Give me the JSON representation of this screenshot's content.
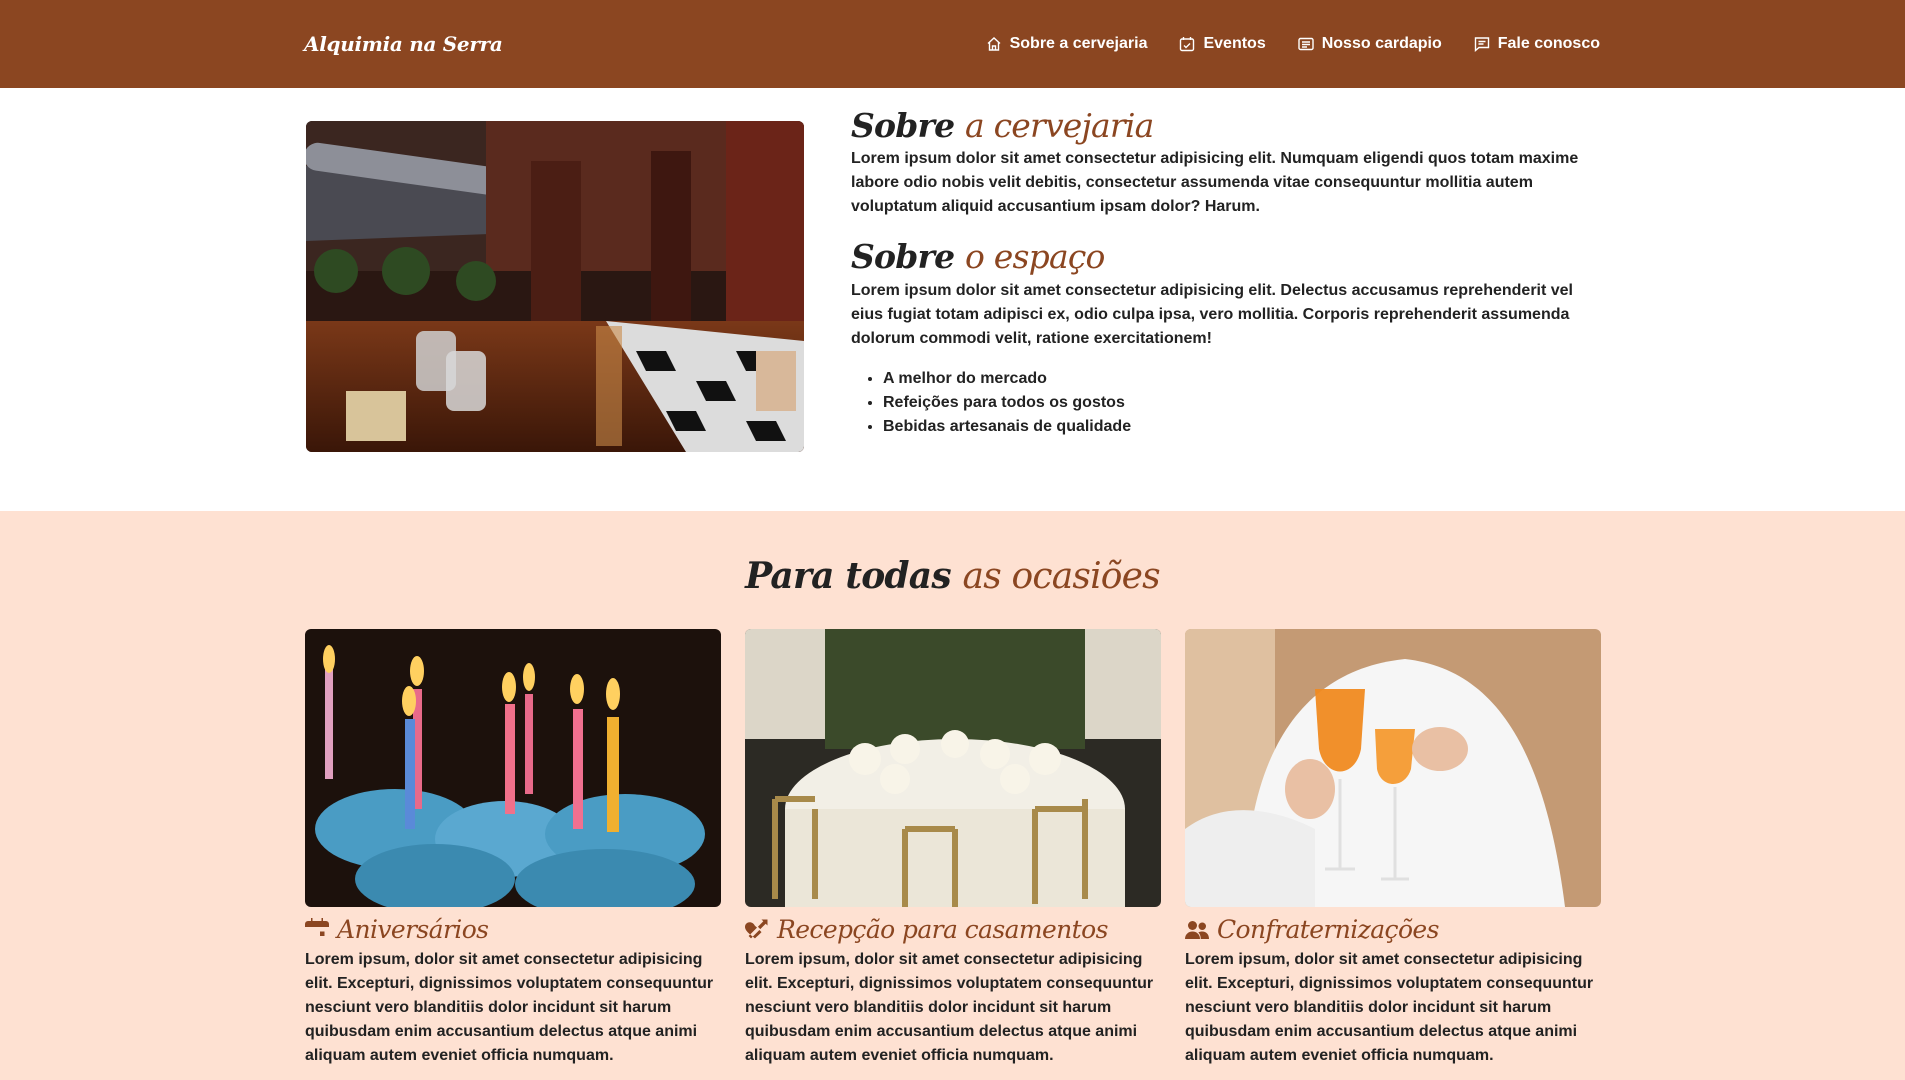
{
  "brand": "Alquimia na Serra",
  "nav": [
    {
      "label": "Sobre a cervejaria",
      "icon": "house-icon"
    },
    {
      "label": "Eventos",
      "icon": "calendar-check-icon"
    },
    {
      "label": "Nosso cardapio",
      "icon": "card-text-icon"
    },
    {
      "label": "Fale conosco",
      "icon": "chat-square-text-icon"
    }
  ],
  "about": {
    "heading1_a": "Sobre",
    "heading1_b": "a cervejaria",
    "para1": "Lorem ipsum dolor sit amet consectetur adipisicing elit. Numquam eligendi quos totam maxime labore odio nobis velit debitis, consectetur assumenda vitae consequuntur mollitia autem voluptatum aliquid accusantium ipsam dolor? Harum.",
    "heading2_a": "Sobre",
    "heading2_b": "o espaço",
    "para2": "Lorem ipsum dolor sit amet consectetur adipisicing elit. Delectus accusamus reprehenderit vel eius fugiat totam adipisci ex, odio culpa ipsa, vero mollitia. Corporis reprehenderit assumenda dolorum commodi velit, ratione exercitationem!",
    "bullets": [
      "A melhor do mercado",
      "Refeições para todos os gostos",
      "Bebidas artesanais de qualidade"
    ]
  },
  "occasions": {
    "title_a": "Para todas",
    "title_b": "as ocasiões",
    "cards": [
      {
        "title": "Aniversários",
        "icon": "calendar-event-icon",
        "text": "Lorem ipsum, dolor sit amet consectetur adipisicing elit. Excepturi, dignissimos voluptatem consequuntur nesciunt vero blanditiis dolor incidunt sit harum quibusdam enim accusantium delectus atque animi aliquam autem eveniet officia numquam."
      },
      {
        "title": "Recepção para casamentos",
        "icon": "heart-arrow-icon",
        "text": "Lorem ipsum, dolor sit amet consectetur adipisicing elit. Excepturi, dignissimos voluptatem consequuntur nesciunt vero blanditiis dolor incidunt sit harum quibusdam enim accusantium delectus atque animi aliquam autem eveniet officia numquam."
      },
      {
        "title": "Confraternizações",
        "icon": "people-icon",
        "text": "Lorem ipsum, dolor sit amet consectetur adipisicing elit. Excepturi, dignissimos voluptatem consequuntur nesciunt vero blanditiis dolor incidunt sit harum quibusdam enim accusantium delectus atque animi aliquam autem eveniet officia numquam."
      }
    ]
  },
  "colors": {
    "accent": "#8b4621",
    "occasions_bg": "#fee1d2",
    "text": "#222222"
  }
}
